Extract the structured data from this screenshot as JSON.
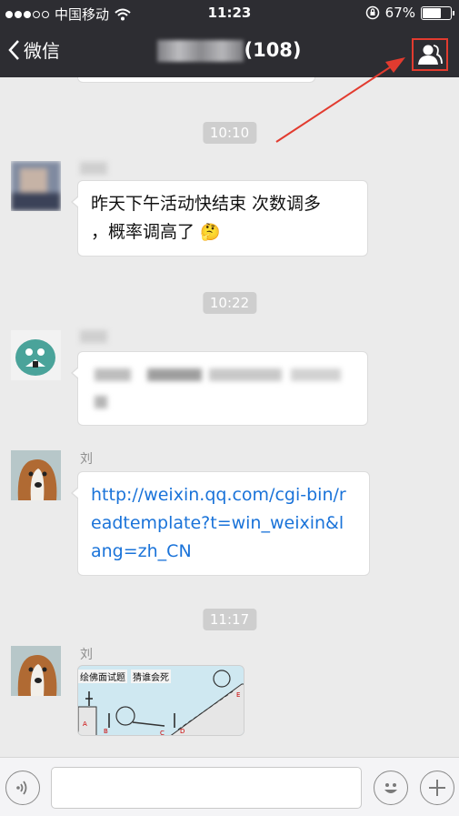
{
  "status_bar": {
    "carrier": "中国移动",
    "time": "11:23",
    "battery": "67%",
    "battery_level": 0.67
  },
  "nav": {
    "back_label": "微信",
    "member_count": "(108)"
  },
  "messages": [
    {
      "time": "10:10"
    },
    {
      "text_line1": "昨天下午活动快结束 次数调多",
      "text_line2": "，概率调高了",
      "emoji": "🤔"
    },
    {
      "time": "10:22"
    },
    {
      "sender": "刘",
      "link_line1": "http://weixin.qq.com/cgi-bin/r",
      "link_line2": "eadtemplate?t=win_weixin&l",
      "link_line3": "ang=zh_CN"
    },
    {
      "time": "11:17"
    },
    {
      "sender": "刘",
      "image_caption_left": "绘佛面试题",
      "image_caption_right": "猜谁会死"
    }
  ],
  "colors": {
    "nav_bg": "#2d2d32",
    "chat_bg": "#ebebeb",
    "link": "#1a73d9",
    "annotation": "#e23b2f"
  },
  "icons": [
    "back-chevron-icon",
    "wifi-icon",
    "rotation-lock-icon",
    "members-icon",
    "voice-icon",
    "emoji-icon",
    "plus-icon"
  ]
}
